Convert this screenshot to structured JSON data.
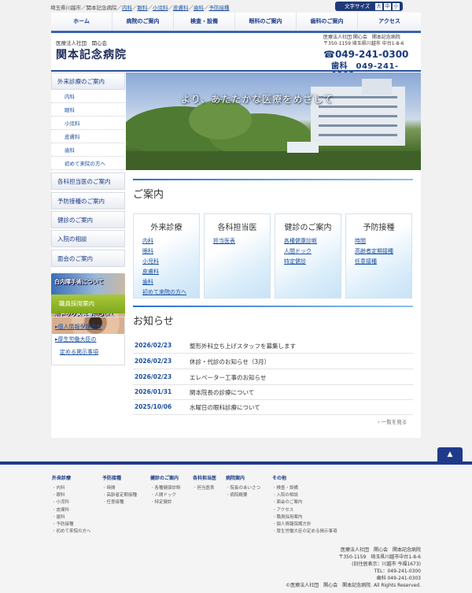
{
  "breadcrumb": {
    "prefix": "埼玉県川越市／関本記念病院／",
    "links": [
      "内科",
      "眼科",
      "小児科",
      "皮膚科",
      "歯科",
      "予防接種"
    ]
  },
  "font_size": {
    "label": "文字サイズ",
    "options": [
      "大",
      "中",
      "小"
    ]
  },
  "gnav": [
    "ホーム",
    "病院のご案内",
    "検査・設備",
    "眼科のご案内",
    "歯科のご案内",
    "アクセス"
  ],
  "header": {
    "logo_sub": "医療法人社団　関心会",
    "logo_main": "関本記念病院",
    "address": "医療法人社団 関心会　関本記念病院\n〒350-1159 埼玉県川越市 中台1-8-6",
    "tel": "049-241-0300",
    "tel_dental_label": "歯科",
    "tel_dental": "049-241-0303"
  },
  "sidebar": {
    "head": "外来診療のご案内",
    "subs": [
      "内科",
      "眼科",
      "小児科",
      "皮膚科",
      "歯科",
      "初めて来院の方へ"
    ],
    "items": [
      "各科担当医のご案内",
      "予防接種のご案内",
      "健診のご案内",
      "入院の相談",
      "面会のご案内"
    ],
    "banners": [
      "白内障手術について",
      "ボトックス治療について"
    ],
    "recruit": "職員採用案内",
    "links": [
      "個人情報保護方針",
      "厚生労働大臣の",
      "定める掲示事項"
    ]
  },
  "hero": {
    "caption": "より、あたたかな医療をめざして"
  },
  "guide": {
    "title": "ご案内",
    "cards": [
      {
        "title": "外来診療",
        "links": [
          "内科",
          "眼科",
          "小児科",
          "皮膚科",
          "歯科",
          "初めて来院の方へ"
        ]
      },
      {
        "title": "各科担当医",
        "links": [
          "担当医表"
        ]
      },
      {
        "title": "健診のご案内",
        "links": [
          "各種健康診断",
          "人間ドック",
          "特定健診"
        ]
      },
      {
        "title": "予防接種",
        "links": [
          "時間",
          "高齢者定期接種",
          "任意接種"
        ]
      }
    ]
  },
  "news": {
    "title": "お知らせ",
    "items": [
      {
        "date": "2026/02/23",
        "text": "整形外科立ち上げスタッフを募集します"
      },
      {
        "date": "2026/02/23",
        "text": "休診・代診のお知らせ（3月）"
      },
      {
        "date": "2026/02/23",
        "text": "エレベーター工事のお知らせ"
      },
      {
        "date": "2026/01/31",
        "text": "関本院長の診療について"
      },
      {
        "date": "2025/10/06",
        "text": "水曜日の眼科診療について"
      }
    ],
    "more": "一覧を見る"
  },
  "footer": {
    "columns": [
      {
        "head": "外来診療",
        "items": [
          "内科",
          "眼科",
          "小児科",
          "皮膚科",
          "歯科",
          "予防接種",
          "初めて来院の方へ"
        ]
      },
      {
        "head": "予防接種",
        "items": [
          "時間",
          "高齢者定期接種",
          "任意接種"
        ]
      },
      {
        "head": "健診のご案内",
        "items": [
          "各種健康診断",
          "人間ドック",
          "特定健診"
        ]
      },
      {
        "head": "各科担当医",
        "items": [
          "担当医表"
        ]
      },
      {
        "head": "病院案内",
        "items": [
          "院長のあいさつ",
          "病院概要"
        ]
      },
      {
        "head": "その他",
        "items": [
          "検査・設備",
          "入院の相談",
          "面会のご案内",
          "アクセス",
          "職員採用案内",
          "個人情報保護方針",
          "厚生労働大臣の定める掲示事項"
        ]
      }
    ],
    "address": "医療法人社団　関心会　関本記念病院\n〒350-1159　埼玉県川越市中台1-8-6\n(旧住居表示：川越市 今福1673)\nTEL：049-241-0300\n歯科 049-241-0303\n©医療法人社団　関心会　関本記念病院. All Rights Reserved."
  },
  "colors": {
    "navy": "#1f3a8a",
    "link": "#1a4fa0",
    "recruit_green": "#8cb42a"
  }
}
